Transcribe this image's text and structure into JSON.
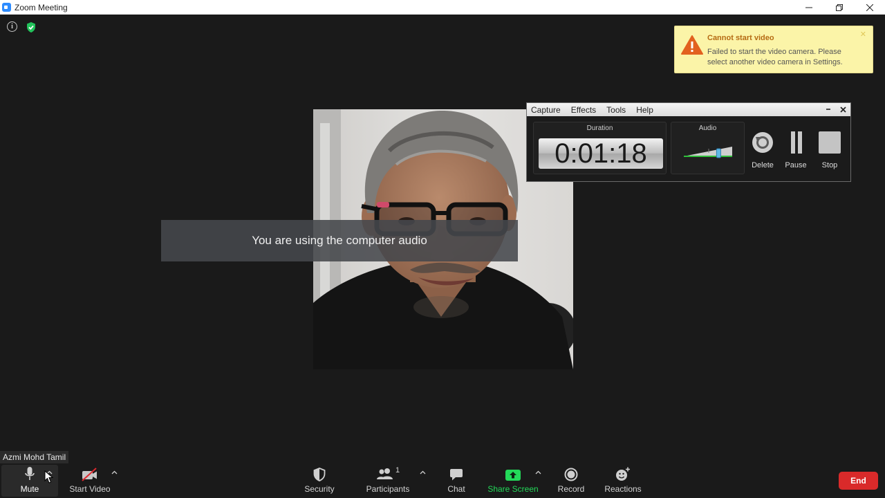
{
  "window": {
    "title": "Zoom Meeting",
    "controls": [
      "minimize",
      "restore",
      "close"
    ]
  },
  "alert": {
    "title": "Cannot start video",
    "message": "Failed to start the video camera. Please select another video camera in Settings.",
    "close_glyph": "✕",
    "icon": "warning-icon",
    "accent": "#e2611f"
  },
  "audio_toast": {
    "text": "You are using the computer audio"
  },
  "participant": {
    "name": "Azmi Mohd Tamil"
  },
  "recorder": {
    "menu": [
      "Capture",
      "Effects",
      "Tools",
      "Help"
    ],
    "duration_label": "Duration",
    "duration_value": "0:01:18",
    "audio_label": "Audio",
    "audio_level": 0.72,
    "buttons": {
      "delete": "Delete",
      "pause": "Pause",
      "stop": "Stop"
    }
  },
  "toolbar": {
    "mute": "Mute",
    "start_video": "Start Video",
    "security": "Security",
    "participants": "Participants",
    "participants_count": "1",
    "chat": "Chat",
    "share_screen": "Share Screen",
    "record": "Record",
    "reactions": "Reactions",
    "end": "End",
    "colors": {
      "share_green": "#23d959",
      "end_red": "#d92a2a",
      "security_green": "#22c35b"
    }
  }
}
